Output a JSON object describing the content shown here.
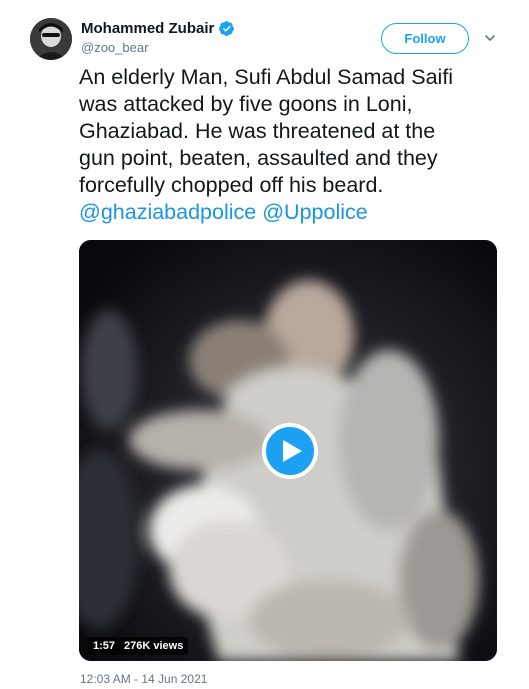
{
  "author": {
    "display_name": "Mohammed Zubair",
    "handle": "@zoo_bear",
    "verified": true
  },
  "actions": {
    "follow_label": "Follow"
  },
  "tweet": {
    "text_lines": [
      "An elderly Man, Sufi Abdul Samad Saifi",
      "was attacked by five goons in Loni,",
      "Ghaziabad.  He was threatened at the",
      "gun point, beaten, assaulted and they",
      "forcefully chopped off his beard."
    ],
    "mentions": [
      "@ghaziabadpolice",
      "@Uppolice"
    ]
  },
  "video": {
    "duration": "1:57",
    "views": "276K views"
  },
  "timestamp": "12:03 AM - 14 Jun 2021",
  "colors": {
    "brand": "#1da1f2",
    "link": "#1b95e0",
    "secondary_text": "#657786",
    "primary_text": "#14171a"
  },
  "icons": [
    "verified-badge-icon",
    "chevron-down-icon",
    "play-icon"
  ]
}
